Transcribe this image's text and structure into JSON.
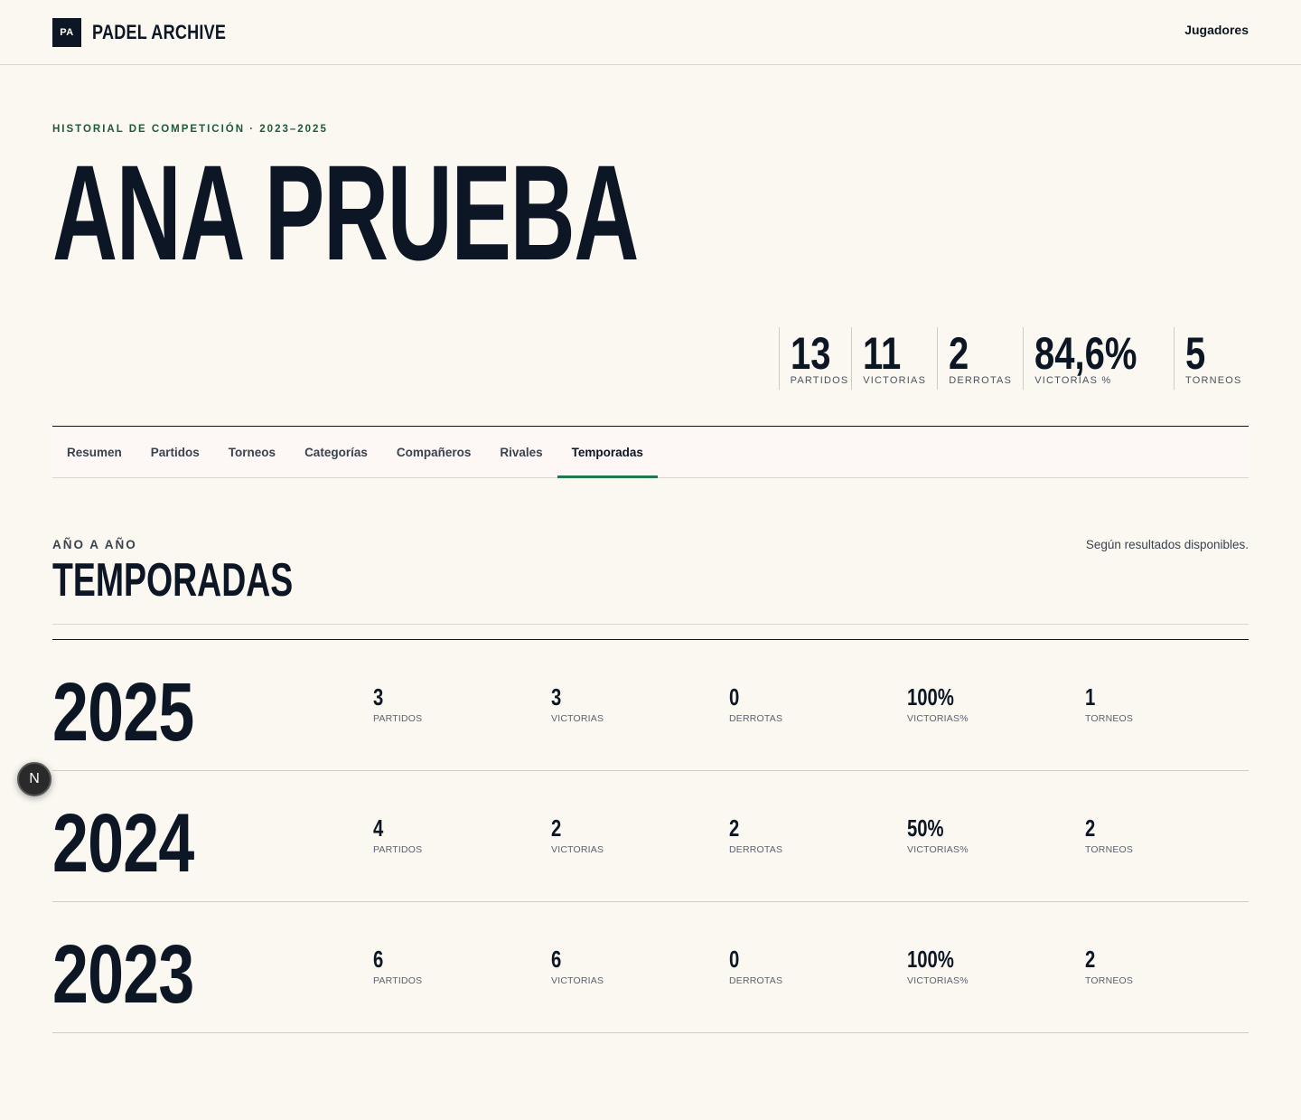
{
  "header": {
    "logo_mark": "PA",
    "logo_text": "PADEL ARCHIVE",
    "nav_link": "Jugadores"
  },
  "hero": {
    "eyebrow": "HISTORIAL DE COMPETICIÓN · 2023–2025",
    "name": "ANA PRUEBA"
  },
  "stats": [
    {
      "value": "13",
      "label": "PARTIDOS"
    },
    {
      "value": "11",
      "label": "VICTORIAS"
    },
    {
      "value": "2",
      "label": "DERROTAS"
    },
    {
      "value": "84,6%",
      "label": "VICTORIAS %"
    },
    {
      "value": "5",
      "label": "TORNEOS"
    }
  ],
  "tabs": [
    {
      "label": "Resumen",
      "active": false
    },
    {
      "label": "Partidos",
      "active": false
    },
    {
      "label": "Torneos",
      "active": false
    },
    {
      "label": "Categorías",
      "active": false
    },
    {
      "label": "Compañeros",
      "active": false
    },
    {
      "label": "Rivales",
      "active": false
    },
    {
      "label": "Temporadas",
      "active": true
    }
  ],
  "section": {
    "eyebrow": "AÑO A AÑO",
    "title": "TEMPORADAS",
    "note": "Según resultados disponibles."
  },
  "seasons": [
    {
      "year": "2025",
      "cells": [
        {
          "value": "3",
          "label": "PARTIDOS"
        },
        {
          "value": "3",
          "label": "VICTORIAS"
        },
        {
          "value": "0",
          "label": "DERROTAS"
        },
        {
          "value": "100%",
          "label": "VICTORIAS%"
        },
        {
          "value": "1",
          "label": "TORNEOS"
        }
      ]
    },
    {
      "year": "2024",
      "cells": [
        {
          "value": "4",
          "label": "PARTIDOS"
        },
        {
          "value": "2",
          "label": "VICTORIAS"
        },
        {
          "value": "2",
          "label": "DERROTAS"
        },
        {
          "value": "50%",
          "label": "VICTORIAS%"
        },
        {
          "value": "2",
          "label": "TORNEOS"
        }
      ]
    },
    {
      "year": "2023",
      "cells": [
        {
          "value": "6",
          "label": "PARTIDOS"
        },
        {
          "value": "6",
          "label": "VICTORIAS"
        },
        {
          "value": "0",
          "label": "DERROTAS"
        },
        {
          "value": "100%",
          "label": "VICTORIAS%"
        },
        {
          "value": "2",
          "label": "TORNEOS"
        }
      ]
    }
  ],
  "badge": {
    "letter": "N"
  },
  "colors": {
    "accent": "#1e7a4a",
    "ink": "#0c1624",
    "background": "#faf8f1",
    "eyebrow": "#1d5a36"
  }
}
